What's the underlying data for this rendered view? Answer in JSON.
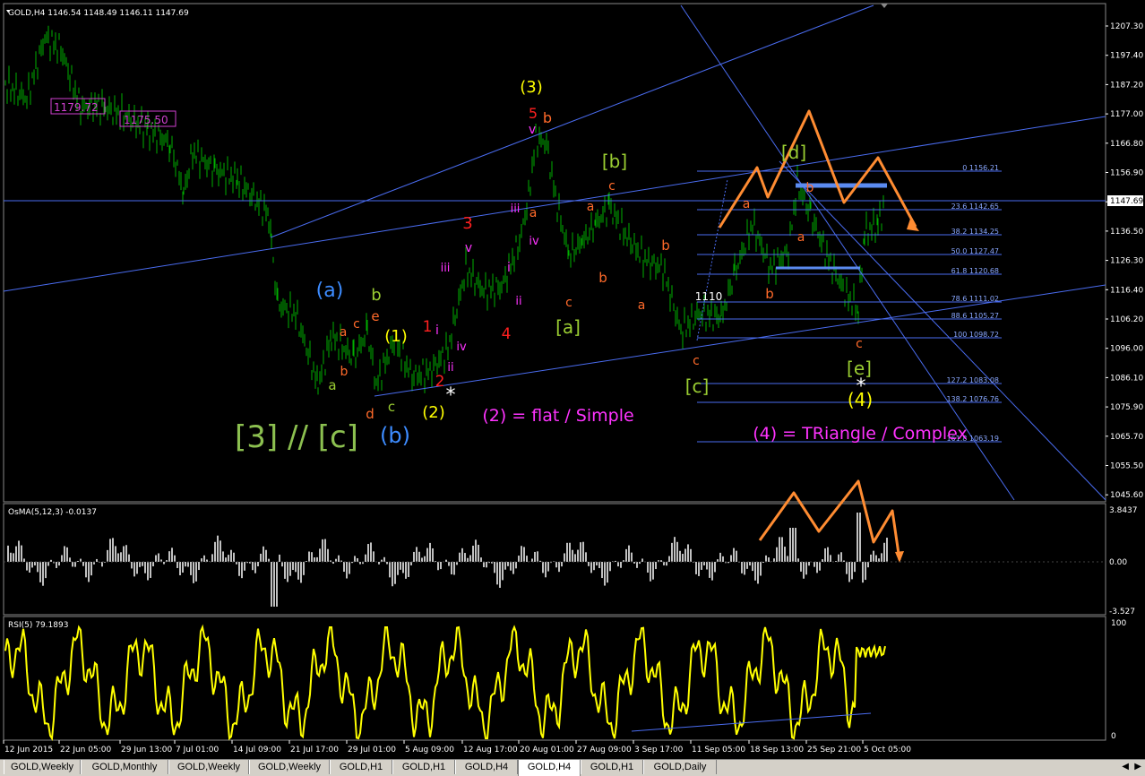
{
  "window": {
    "symbol_label": "GOLD,H4",
    "ohlc": "1146.54 1148.49 1146.11 1147.69"
  },
  "price_axis": {
    "ticks": [
      "1207.30",
      "1197.40",
      "1187.20",
      "1177.00",
      "1166.80",
      "1156.90",
      "1146.60",
      "1136.50",
      "1126.30",
      "1116.40",
      "1106.20",
      "1096.00",
      "1086.10",
      "1075.90",
      "1065.70",
      "1055.50",
      "1045.60"
    ],
    "current": "1147.69"
  },
  "time_axis": {
    "ticks": [
      "12 Jun 2015",
      "22 Jun 05:00",
      "29 Jun 13:00",
      "7 Jul 01:00",
      "14 Jul 09:00",
      "21 Jul 17:00",
      "29 Jul 01:00",
      "5 Aug 09:00",
      "12 Aug 17:00",
      "20 Aug 01:00",
      "27 Aug 09:00",
      "3 Sep 17:00",
      "11 Sep 05:00",
      "18 Sep 13:00",
      "25 Sep 21:00",
      "5 Oct 05:00"
    ]
  },
  "price_boxes": [
    "1179.72",
    "1175.50"
  ],
  "fibo_levels": [
    "0 1156.21",
    "23.6 1142.65",
    "38.2 1134.25",
    "50.0 1127.47",
    "61.8 1120.68",
    "78.6 1111.02",
    "88.6 1105.27",
    "100 1098.72",
    "127.2 1083.08",
    "138.2 1076.76",
    "161.8 1063.19"
  ],
  "labels": {
    "wave3": "(3)",
    "five": "5",
    "b_top": "b",
    "v_top": "v",
    "iii_top": "iii",
    "a_top": "a",
    "iv_top": "iv",
    "b_green": "[b]",
    "c_top": "c",
    "a2": "a",
    "b2": "b",
    "b3": "b",
    "a3": "a",
    "three_red": "3",
    "v2": "v",
    "iii2": "iii",
    "i2": "i",
    "ii2": "ii",
    "four_red": "4",
    "c2": "c",
    "a_green": "[a]",
    "a_blue": "(a)",
    "b_gr": "b",
    "e_red": "e",
    "c_red": "c",
    "a_red": "a",
    "b_red2": "b",
    "a_gr2": "a",
    "d_red": "d",
    "c_gr": "c",
    "b_blue": "(b)",
    "wave1": "(1)",
    "one_red": "1",
    "i_red": "i",
    "iv_mag": "iv",
    "ii_mag": "ii",
    "two_red": "2",
    "wave2": "(2)",
    "star1": "*",
    "big_left": "[3] // [c]",
    "flat": "(2) = flat / Simple",
    "p1110": "1110",
    "c_bot": "c",
    "c_green": "[c]",
    "d_green": "[d]",
    "b_r4": "b",
    "a_r4": "a",
    "a_r5": "a",
    "b_r5": "b",
    "c_r6": "c",
    "e_green": "[e]",
    "star2": "*",
    "wave4": "(4)",
    "triangle": "(4) = TRiangle / Complex"
  },
  "osma": {
    "title": "OsMA(5,12,3) -0.0137",
    "ticks": [
      "3.8437",
      "0.00",
      "-3.527"
    ]
  },
  "rsi": {
    "title": "RSI(5) 79.1893",
    "ticks": [
      "100",
      "0"
    ]
  },
  "tabs": [
    "GOLD,Weekly",
    "GOLD,Monthly",
    "GOLD,Weekly",
    "GOLD,Weekly",
    "GOLD,H1",
    "GOLD,H1",
    "GOLD,H4",
    "GOLD,H4",
    "GOLD,H1",
    "GOLD,Daily"
  ],
  "active_tab": 7,
  "colors": {
    "candles": "#00b000",
    "axis": "#ffffff",
    "blue_line": "#4a6cf0",
    "orange": "#ff8c32",
    "yellow": "#ffff00",
    "red": "#ff2020",
    "magenta": "#ff33ff",
    "green_label": "#9acd32",
    "blue_label": "#3d8cff",
    "osma_bar": "#c0c0c0",
    "rsi": "#ffff00"
  },
  "chart_data": [
    {
      "type": "line",
      "title": "GOLD,H4",
      "ylim": [
        1045.6,
        1210
      ],
      "y_ticks": [
        1207.3,
        1197.4,
        1187.2,
        1177.0,
        1166.8,
        1156.9,
        1146.6,
        1136.5,
        1126.3,
        1116.4,
        1106.2,
        1096.0,
        1086.1,
        1075.9,
        1065.7,
        1055.5,
        1045.6
      ],
      "x": [
        "12 Jun 2015",
        "22 Jun 05:00",
        "29 Jun 13:00",
        "7 Jul 01:00",
        "14 Jul 09:00",
        "21 Jul 17:00",
        "29 Jul 01:00",
        "5 Aug 09:00",
        "12 Aug 17:00",
        "20 Aug 01:00",
        "27 Aug 09:00",
        "3 Sep 17:00",
        "11 Sep 05:00",
        "18 Sep 13:00",
        "25 Sep 21:00",
        "5 Oct 05:00"
      ],
      "series": [
        {
          "values": [
            1188,
            1200,
            1182,
            1168,
            1160,
            1112,
            1084,
            1088,
            1098,
            1165,
            1148,
            1105,
            1122,
            1152,
            1108,
            1147.69
          ]
        }
      ]
    },
    {
      "type": "bar",
      "title": "OsMA(5,12,3) -0.0137",
      "ylim": [
        -3.527,
        3.8437
      ],
      "values": [
        0.5,
        1.5,
        -1.2,
        2.5,
        0.8,
        -1.5,
        1.9,
        0.3,
        -2.1,
        0.7,
        2.2,
        -0.9,
        1.1,
        -1.8,
        0.4,
        1.2,
        -0.6,
        2.8,
        -1.0,
        1.8,
        0.1,
        -1.3,
        2.0,
        0.8
      ]
    },
    {
      "type": "line",
      "title": "RSI(5) 79.1893",
      "ylim": [
        0,
        100
      ],
      "values": [
        55,
        80,
        30,
        20,
        65,
        25,
        45,
        60,
        30,
        10,
        75,
        40,
        55,
        20,
        70,
        35,
        90,
        25,
        85,
        40,
        20,
        55,
        85,
        15,
        80,
        60,
        30,
        85,
        25,
        50,
        80
      ]
    }
  ]
}
